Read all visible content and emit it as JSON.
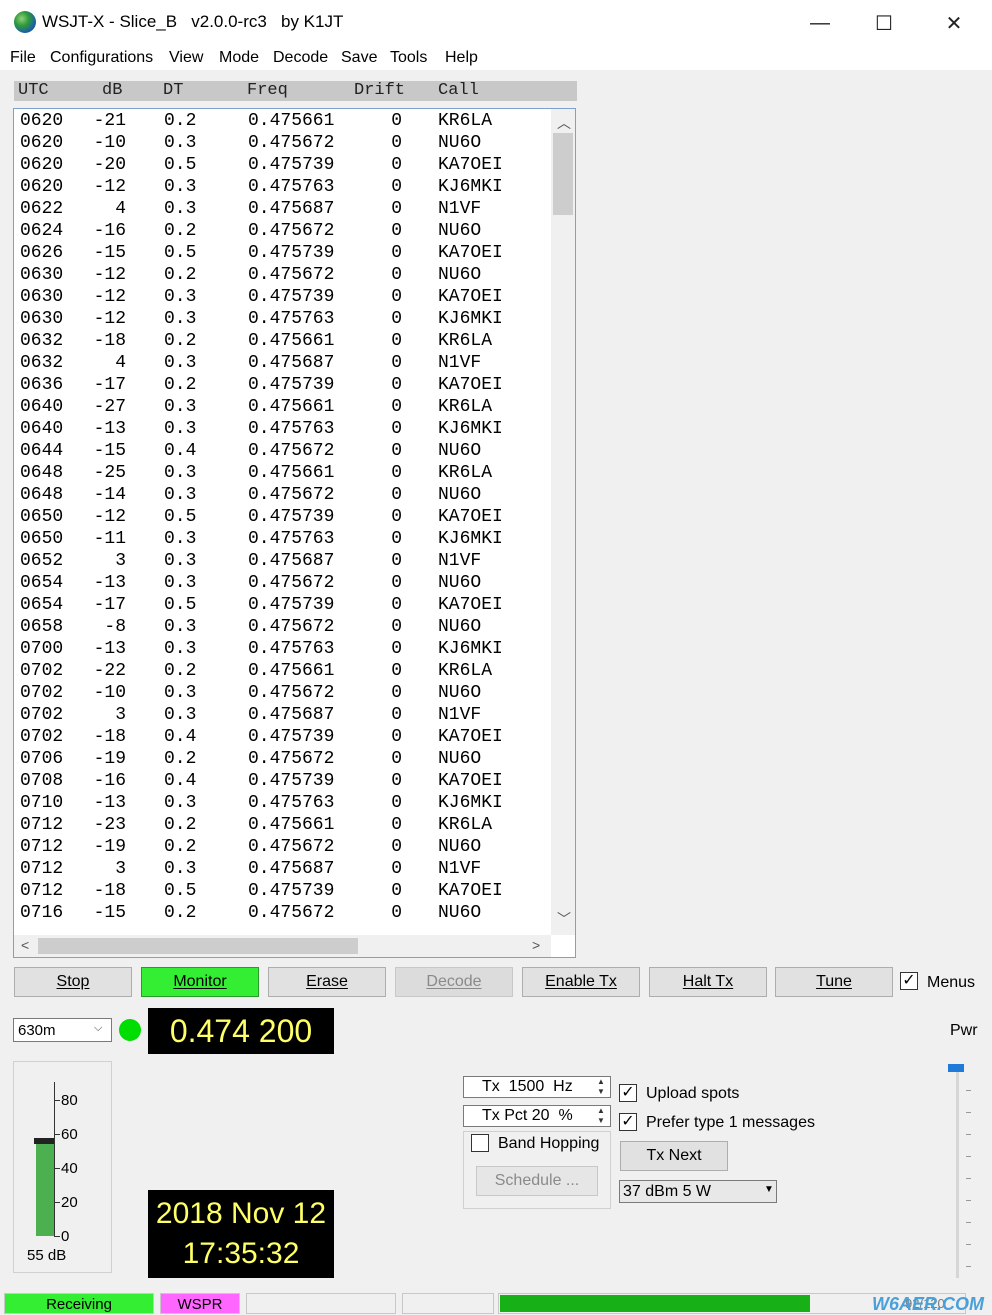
{
  "window": {
    "title": "WSJT-X - Slice_B   v2.0.0-rc3   by K1JT",
    "minimize": "—",
    "maximize": "☐",
    "close": "✕"
  },
  "menu": [
    "File",
    "Configurations",
    "View",
    "Mode",
    "Decode",
    "Save",
    "Tools",
    "Help"
  ],
  "columns": [
    "UTC",
    "dB",
    "DT",
    "Freq",
    "Drift",
    "Call"
  ],
  "rows": [
    [
      "0620",
      "-21",
      "0.2",
      "0.475661",
      "0",
      "KR6LA"
    ],
    [
      "0620",
      "-10",
      "0.3",
      "0.475672",
      "0",
      "NU6O"
    ],
    [
      "0620",
      "-20",
      "0.5",
      "0.475739",
      "0",
      "KA7OEI"
    ],
    [
      "0620",
      "-12",
      "0.3",
      "0.475763",
      "0",
      "KJ6MKI"
    ],
    [
      "0622",
      "4",
      "0.3",
      "0.475687",
      "0",
      "N1VF"
    ],
    [
      "0624",
      "-16",
      "0.2",
      "0.475672",
      "0",
      "NU6O"
    ],
    [
      "0626",
      "-15",
      "0.5",
      "0.475739",
      "0",
      "KA7OEI"
    ],
    [
      "0630",
      "-12",
      "0.2",
      "0.475672",
      "0",
      "NU6O"
    ],
    [
      "0630",
      "-12",
      "0.3",
      "0.475739",
      "0",
      "KA7OEI"
    ],
    [
      "0630",
      "-12",
      "0.3",
      "0.475763",
      "0",
      "KJ6MKI"
    ],
    [
      "0632",
      "-18",
      "0.2",
      "0.475661",
      "0",
      "KR6LA"
    ],
    [
      "0632",
      "4",
      "0.3",
      "0.475687",
      "0",
      "N1VF"
    ],
    [
      "0636",
      "-17",
      "0.2",
      "0.475739",
      "0",
      "KA7OEI"
    ],
    [
      "0640",
      "-27",
      "0.3",
      "0.475661",
      "0",
      "KR6LA"
    ],
    [
      "0640",
      "-13",
      "0.3",
      "0.475763",
      "0",
      "KJ6MKI"
    ],
    [
      "0644",
      "-15",
      "0.4",
      "0.475672",
      "0",
      "NU6O"
    ],
    [
      "0648",
      "-25",
      "0.3",
      "0.475661",
      "0",
      "KR6LA"
    ],
    [
      "0648",
      "-14",
      "0.3",
      "0.475672",
      "0",
      "NU6O"
    ],
    [
      "0650",
      "-12",
      "0.5",
      "0.475739",
      "0",
      "KA7OEI"
    ],
    [
      "0650",
      "-11",
      "0.3",
      "0.475763",
      "0",
      "KJ6MKI"
    ],
    [
      "0652",
      "3",
      "0.3",
      "0.475687",
      "0",
      "N1VF"
    ],
    [
      "0654",
      "-13",
      "0.3",
      "0.475672",
      "0",
      "NU6O"
    ],
    [
      "0654",
      "-17",
      "0.5",
      "0.475739",
      "0",
      "KA7OEI"
    ],
    [
      "0658",
      "-8",
      "0.3",
      "0.475672",
      "0",
      "NU6O"
    ],
    [
      "0700",
      "-13",
      "0.3",
      "0.475763",
      "0",
      "KJ6MKI"
    ],
    [
      "0702",
      "-22",
      "0.2",
      "0.475661",
      "0",
      "KR6LA"
    ],
    [
      "0702",
      "-10",
      "0.3",
      "0.475672",
      "0",
      "NU6O"
    ],
    [
      "0702",
      "3",
      "0.3",
      "0.475687",
      "0",
      "N1VF"
    ],
    [
      "0702",
      "-18",
      "0.4",
      "0.475739",
      "0",
      "KA7OEI"
    ],
    [
      "0706",
      "-19",
      "0.2",
      "0.475672",
      "0",
      "NU6O"
    ],
    [
      "0708",
      "-16",
      "0.4",
      "0.475739",
      "0",
      "KA7OEI"
    ],
    [
      "0710",
      "-13",
      "0.3",
      "0.475763",
      "0",
      "KJ6MKI"
    ],
    [
      "0712",
      "-23",
      "0.2",
      "0.475661",
      "0",
      "KR6LA"
    ],
    [
      "0712",
      "-19",
      "0.2",
      "0.475672",
      "0",
      "NU6O"
    ],
    [
      "0712",
      "3",
      "0.3",
      "0.475687",
      "0",
      "N1VF"
    ],
    [
      "0712",
      "-18",
      "0.5",
      "0.475739",
      "0",
      "KA7OEI"
    ],
    [
      "0716",
      "-15",
      "0.2",
      "0.475672",
      "0",
      "NU6O"
    ]
  ],
  "buttons": {
    "stop": "Stop",
    "monitor": "Monitor",
    "erase": "Erase",
    "decode": "Decode",
    "enable_tx": "Enable Tx",
    "halt_tx": "Halt Tx",
    "tune": "Tune"
  },
  "menus_checkbox": {
    "label": "Menus",
    "checked": true
  },
  "band": "630m",
  "dial_freq": "0.474 200",
  "pwr_label": "Pwr",
  "meter": {
    "ticks": [
      "80",
      "60",
      "40",
      "20",
      "0"
    ],
    "level_db": "55 dB"
  },
  "clock": {
    "date": "2018 Nov 12",
    "time": "17:35:32"
  },
  "tx_freq": "Tx  1500  Hz",
  "tx_pct": "Tx Pct 20  %",
  "band_hopping": "Band Hopping",
  "schedule": "Schedule ...",
  "upload_spots": "Upload spots",
  "prefer_type1": "Prefer type 1 messages",
  "tx_next": "Tx Next",
  "power": "37 dBm  5 W",
  "status": {
    "receiving": "Receiving",
    "mode": "WSPR",
    "progress": 0.72,
    "counter": "92/120"
  },
  "watermark": "W6AER.COM",
  "colors": {
    "monitor_active": "#33ee33",
    "led": "#00dd00",
    "display_text": "#ffff66",
    "wspr_badge": "#ff66ff",
    "progress": "#17b017"
  }
}
